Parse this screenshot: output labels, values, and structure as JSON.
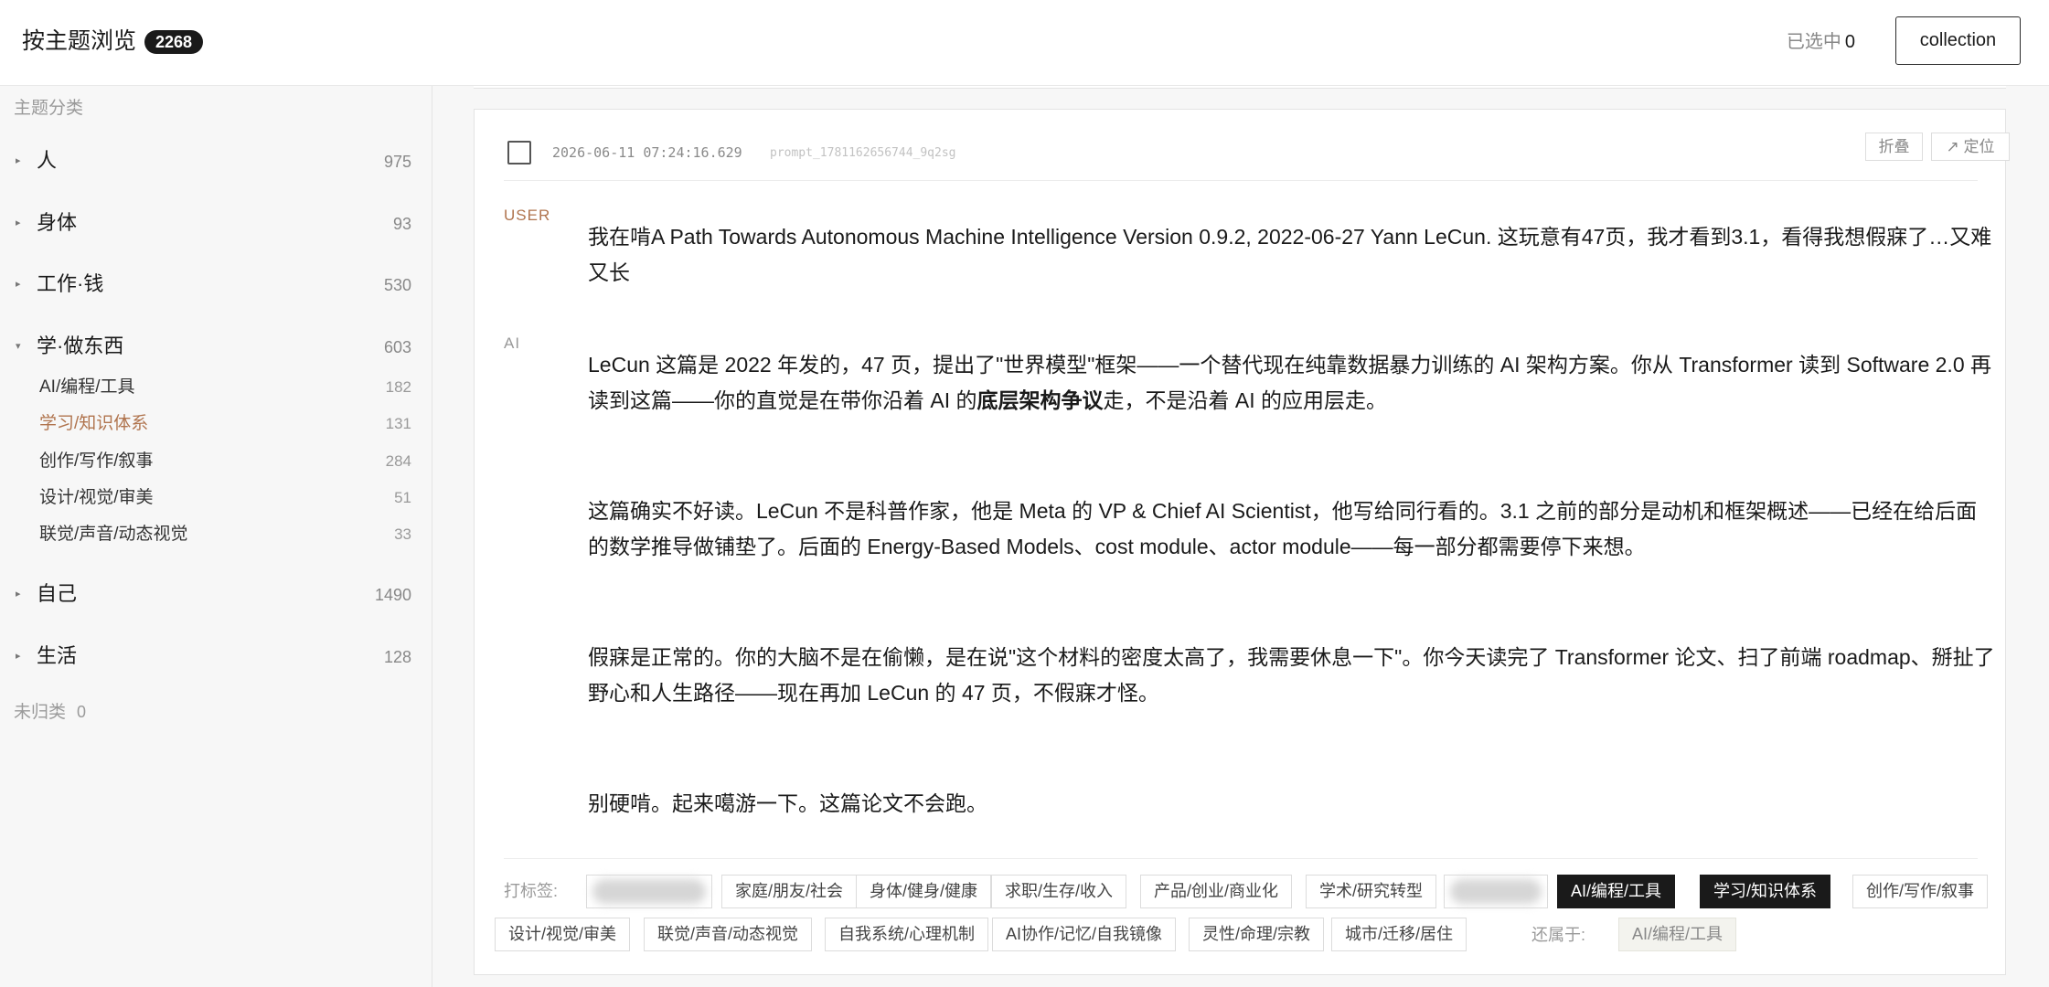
{
  "header": {
    "title": "按主题浏览",
    "total": "2268",
    "selected_label": "已选中",
    "selected_count": "0",
    "collection_label": "collection"
  },
  "sidebar": {
    "heading": "主题分类",
    "categories": [
      {
        "label": "人",
        "count": "975",
        "arrow": "▸"
      },
      {
        "label": "身体",
        "count": "93",
        "arrow": "▸"
      },
      {
        "label": "工作·钱",
        "count": "530",
        "arrow": "▸"
      },
      {
        "label": "学·做东西",
        "count": "603",
        "arrow": "▾"
      },
      {
        "label": "自己",
        "count": "1490",
        "arrow": "▸"
      },
      {
        "label": "生活",
        "count": "128",
        "arrow": "▸"
      }
    ],
    "subcategories": [
      {
        "label": "AI/编程/工具",
        "count": "182"
      },
      {
        "label": "学习/知识体系",
        "count": "131"
      },
      {
        "label": "创作/写作/叙事",
        "count": "284"
      },
      {
        "label": "设计/视觉/审美",
        "count": "51"
      },
      {
        "label": "联觉/声音/动态视觉",
        "count": "33"
      }
    ],
    "uncategorized_label": "未归类",
    "uncategorized_count": "0"
  },
  "card": {
    "timestamp": "2026-06-11 07:24:16.629",
    "prompt_id": "prompt_1781162656744_9q2sg",
    "fold_label": "折叠",
    "locate_label": "↗ 定位",
    "user_role": "USER",
    "ai_role": "AI",
    "user_message": "我在啃A Path Towards Autonomous Machine Intelligence Version 0.9.2, 2022-06-27 Yann LeCun. 这玩意有47页，我才看到3.1，看得我想假寐了…又难又长",
    "ai_p1_a": "LeCun 这篇是 2022 年发的，47 页，提出了\"世界模型\"框架——一个替代现在纯靠数据暴力训练的 AI 架构方案。你从 Transformer 读到 Software 2.0 再读到这篇——你的直觉是在带你沿着 AI 的",
    "ai_p1_bold": "底层架构争议",
    "ai_p1_c": "走，不是沿着 AI 的应用层走。",
    "ai_p2": "这篇确实不好读。LeCun 不是科普作家，他是 Meta 的 VP & Chief AI Scientist，他写给同行看的。3.1 之前的部分是动机和框架概述——已经在给后面的数学推导做铺垫了。后面的 Energy-Based Models、cost module、actor module——每一部分都需要停下来想。",
    "ai_p3": "假寐是正常的。你的大脑不是在偷懒，是在说\"这个材料的密度太高了，我需要休息一下\"。你今天读完了 Transformer 论文、扫了前端 roadmap、掰扯了野心和人生路径——现在再加 LeCun 的 47 页，不假寐才怪。",
    "ai_p4": "别硬啃。起来噶游一下。这篇论文不会跑。"
  },
  "tags": {
    "label": "打标签:",
    "chips": [
      {
        "label": "",
        "state": "blurred"
      },
      {
        "label": "家庭/朋友/社会",
        "state": "off"
      },
      {
        "label": "身体/健身/健康",
        "state": "off"
      },
      {
        "label": "求职/生存/收入",
        "state": "off"
      },
      {
        "label": "产品/创业/商业化",
        "state": "off"
      },
      {
        "label": "学术/研究转型",
        "state": "off"
      },
      {
        "label": "",
        "state": "blurred"
      },
      {
        "label": "AI/编程/工具",
        "state": "on"
      },
      {
        "label": "学习/知识体系",
        "state": "on"
      },
      {
        "label": "创作/写作/叙事",
        "state": "off"
      },
      {
        "label": "设计/视觉/审美",
        "state": "off"
      },
      {
        "label": "联觉/声音/动态视觉",
        "state": "off"
      },
      {
        "label": "自我系统/心理机制",
        "state": "off"
      },
      {
        "label": "AI协作/记忆/自我镜像",
        "state": "off"
      },
      {
        "label": "灵性/命理/宗教",
        "state": "off"
      },
      {
        "label": "城市/迁移/居住",
        "state": "off"
      }
    ],
    "belongs_label": "还属于:",
    "belongs_chip": "AI/编程/工具"
  }
}
